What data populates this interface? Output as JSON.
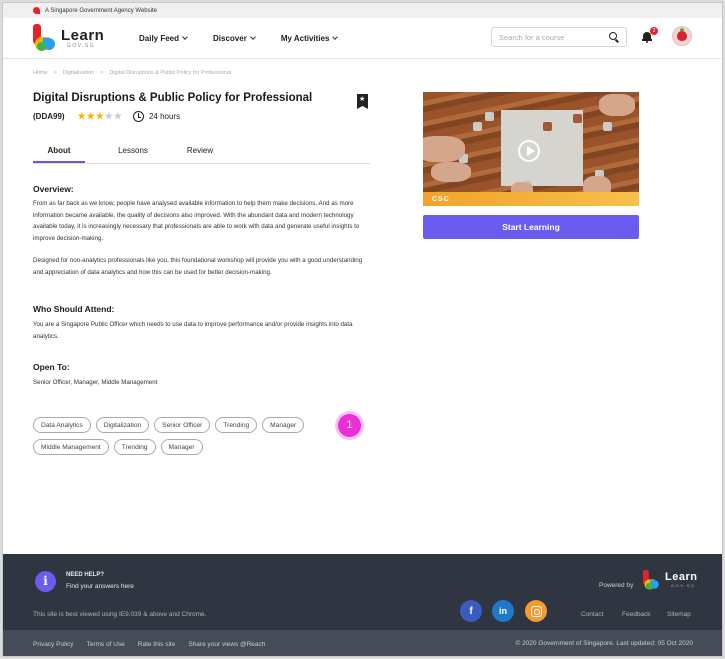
{
  "gov_bar": {
    "text": "A Singapore Government Agency Website"
  },
  "logo": {
    "name": "Learn",
    "sub": "GOV.SG"
  },
  "nav": [
    {
      "label": "Daily Feed"
    },
    {
      "label": "Discover"
    },
    {
      "label": "My Activities"
    }
  ],
  "search": {
    "placeholder": "Search for a course",
    "icon": "search-icon"
  },
  "notifications": {
    "count": "2"
  },
  "breadcrumb": [
    "Home",
    ">",
    "Digitalisation",
    ">",
    "Digital Disruptions & Public Policy for Professional"
  ],
  "course": {
    "title": "Digital Disruptions & Public Policy for Professional",
    "code": "(DDA99)",
    "rating": 3,
    "rating_max": 5,
    "duration": "24 hours"
  },
  "tabs": [
    {
      "label": "About",
      "active": true
    },
    {
      "label": "Lessons",
      "active": false
    },
    {
      "label": "Review",
      "active": false
    }
  ],
  "overview": {
    "heading": "Overview:",
    "para1": "From as far back as we know, people have analysed available information to help them make decisions. And as more information became available, the quality of decisions also improved. With the abundant data and modern technology available today, it is increasingly necessary that professionals are able to work with data and generate useful insights to improve decision-making.",
    "para2": "Designed for non-analytics professionals like you, this foundational workshop will provide you with a good understanding and appreciation of data analytics and how this can be used for better decision-making."
  },
  "who": {
    "heading": "Who Should Attend:",
    "text": "You are a Singapore Public Officer which needs to use data to improve performance and/or provide insights into data analytics."
  },
  "open_to": {
    "heading": "Open To:",
    "text": "Senior Officer, Manager, Middle Management"
  },
  "tags_row1": [
    "Data Analytics",
    "Digitalization",
    "Senior Officer",
    "Trending",
    "Manager"
  ],
  "tags_row2": [
    "Middle Management",
    "Trending",
    "Manager"
  ],
  "hint_badge": "1",
  "video": {
    "banner": "CSC"
  },
  "start_button": "Start Learning",
  "footer": {
    "help_title": "NEED HELP?",
    "help_sub": "Find your answers here",
    "powered_by": "Powered by",
    "browser_note": "This site is best viewed using IE9.039 & above and Chrome.",
    "links": [
      "Contact",
      "Feedback",
      "Sitemap"
    ],
    "bottom_links": [
      "Privacy Policy",
      "Terms of Use",
      "Rate this site",
      "Share your views @Reach"
    ],
    "copyright": "© 2020 Government of Singapore. Last updated: 05 Oct 2020"
  },
  "colors": {
    "accent": "#6b5cf0",
    "footer": "#2f3642",
    "star": "#f7b500"
  }
}
